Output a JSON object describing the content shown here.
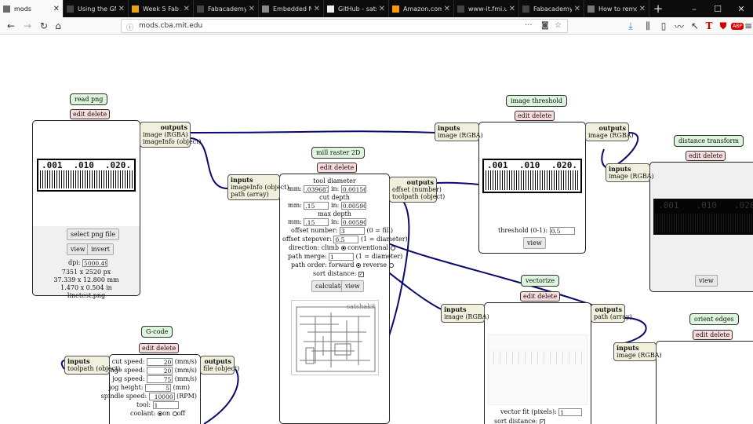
{
  "browser": {
    "tabs": [
      {
        "label": "mods",
        "active": true,
        "fav_color": "#6b6b6b"
      },
      {
        "label": "Using the GNU AVR t",
        "fav_color": "#444"
      },
      {
        "label": "Week 5 Fab Acad",
        "fav_color": "#e8a317"
      },
      {
        "label": "Fabacademy 15ht -Th",
        "fav_color": "#444"
      },
      {
        "label": "Embedded Netw",
        "fav_color": "#888"
      },
      {
        "label": "GitHub - satshak",
        "fav_color": "#eee"
      },
      {
        "label": "Amazon.com : H",
        "fav_color": "#f90"
      },
      {
        "label": "www-it.fmi.uni-sofia",
        "fav_color": "#444"
      },
      {
        "label": "Fabacademy 15ht -Th",
        "fav_color": "#444"
      },
      {
        "label": "How to remove a",
        "fav_color": "#777"
      }
    ],
    "new_tab": "+",
    "window_controls": [
      "–",
      "☐",
      "✕"
    ],
    "url": "mods.cba.mit.edu",
    "more": "···",
    "accent": "#0a84ff"
  },
  "modules": {
    "read_png": {
      "title": "read png",
      "edit_delete": "edit delete",
      "outputs_label": "outputs",
      "out1": "image (RGBA)",
      "out2": "imageInfo (object)",
      "ruler": [
        ".001",
        ".010",
        ".020."
      ],
      "select_btn": "select png file",
      "view_btn": "view",
      "invert_btn": "invert",
      "dpi_label": "dpi:",
      "dpi_value": "5000.498",
      "info1": "7351 x 2520 px",
      "info2": "37.339 x 12.800 mm",
      "info3": "1.470 x 0.504 in",
      "info4": "linetest.png"
    },
    "mill_raster": {
      "title": "mill raster 2D",
      "edit_delete": "edit delete",
      "inputs_label": "inputs",
      "in1": "imageInfo (object)",
      "in2": "path (array)",
      "outputs_label": "outputs",
      "out1": "offset (number)",
      "out2": "toolpath (object)",
      "tool_diameter": "tool diameter",
      "td_mm_label": "mm:",
      "td_mm": ".0396875",
      "td_in_label": "in:",
      "td_in": "0.0015625",
      "cut_depth": "cut depth",
      "cd_mm_label": "mm:",
      "cd_mm": ".15",
      "cd_in_label": "in:",
      "cd_in": "0.0059055",
      "max_depth": "max depth",
      "md_mm_label": "mm:",
      "md_mm": ".15",
      "md_in_label": "in:",
      "md_in": "0.0059055",
      "offset_number_label": "offset number:",
      "offset_number": "3",
      "offset_number_note": "(0 = fill)",
      "offset_stepover_label": "offset stepover:",
      "offset_stepover": "0.5",
      "offset_stepover_note": "(1 = diameter)",
      "direction_label": "direction: climb",
      "conventional": "conventional",
      "path_merge_label": "path merge:",
      "path_merge": "1",
      "path_merge_note": "(1 = diameter)",
      "path_order_label": "path order: forward",
      "reverse": "reverse",
      "sort_distance": "sort distance:",
      "calculate_btn": "calculate",
      "view_btn": "view",
      "preview_label": "satshakit"
    },
    "image_threshold": {
      "title": "image threshold",
      "edit_delete": "edit delete",
      "inputs_label": "inputs",
      "in1": "image (RGBA)",
      "outputs_label": "outputs",
      "out1": "image (RGBA)",
      "ruler": [
        ".001",
        ".010",
        ".020."
      ],
      "threshold_label": "threshold (0-1):",
      "threshold_value": "0.5",
      "view_btn": "view"
    },
    "distance_transform": {
      "title": "distance transform",
      "edit_delete": "edit delete",
      "inputs_label": "inputs",
      "in1": "image (RGBA)",
      "ruler": [
        ".001",
        ".010",
        ".020."
      ],
      "view_btn": "view"
    },
    "vectorize": {
      "title": "vectorize",
      "edit_delete": "edit delete",
      "inputs_label": "inputs",
      "in1": "image (RGBA)",
      "outputs_label": "outputs",
      "out1": "path (array)",
      "vector_fit_label": "vector fit (pixels):",
      "vector_fit": "1",
      "sort_distance": "sort distance:"
    },
    "orient_edges": {
      "title": "orient edges",
      "edit_delete": "edit delete",
      "inputs_label": "inputs",
      "in1": "image (RGBA)"
    },
    "gcode": {
      "title": "G-code",
      "edit_delete": "edit delete",
      "inputs_label": "inputs",
      "in1": "toolpath (object)",
      "outputs_label": "outputs",
      "out1": "file (object)",
      "cut_speed_label": "cut speed:",
      "cut_speed": "20",
      "cut_speed_unit": "(mm/s)",
      "plunge_speed_label": "plunge speed:",
      "plunge_speed": "20",
      "plunge_speed_unit": "(mm/s)",
      "jog_speed_label": "jog speed:",
      "jog_speed": "75",
      "jog_speed_unit": "(mm/s)",
      "jog_height_label": "jog height:",
      "jog_height": "5",
      "jog_height_unit": "(mm)",
      "spindle_speed_label": "spindle speed:",
      "spindle_speed": "10000",
      "spindle_speed_unit": "(RPM)",
      "tool_label": "tool:",
      "tool": "1",
      "coolant_label": "coolant:",
      "coolant_on": "on",
      "coolant_off": "off"
    }
  },
  "colors": {
    "wire": "#0a0a6e",
    "title_bg": "#dcf5dc",
    "edit_bg": "#fadcdc",
    "port_bg": "#f0f0dc"
  }
}
